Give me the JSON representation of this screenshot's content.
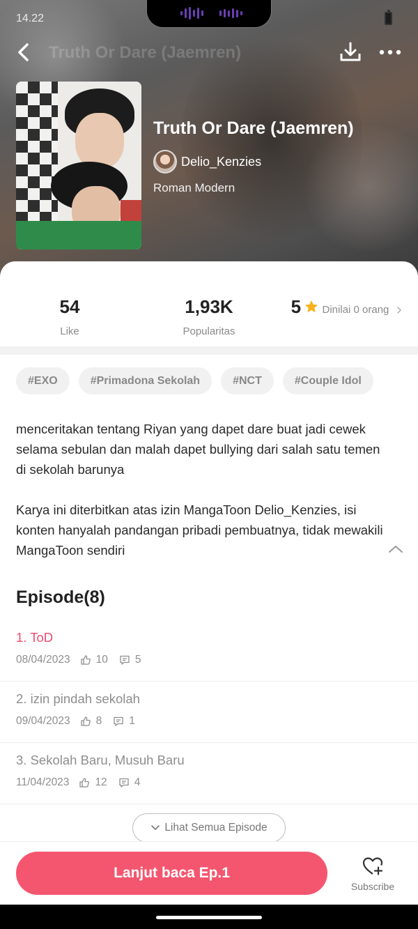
{
  "status_bar": {
    "time": "14.22"
  },
  "header": {
    "title": "Truth Or Dare (Jaemren)"
  },
  "book": {
    "title": "Truth Or Dare (Jaemren)",
    "author": "Delio_Kenzies",
    "genre": "Roman Modern"
  },
  "stats": {
    "likes": {
      "value": "54",
      "label": "Like"
    },
    "popularity": {
      "value": "1,93K",
      "label": "Popularitas"
    },
    "rating": {
      "value": "5",
      "label": "Dinilai 0 orang"
    }
  },
  "tags": [
    "#EXO",
    "#Primadona Sekolah",
    "#NCT",
    "#Couple Idol"
  ],
  "description": {
    "paragraph1": "menceritakan tentang Riyan yang dapet dare buat jadi cewek selama sebulan dan malah dapet bullying dari salah satu temen di sekolah barunya",
    "paragraph2": "Karya ini diterbitkan atas izin MangaToon Delio_Kenzies, isi konten hanyalah pandangan pribadi pembuatnya, tidak mewakili MangaToon sendiri"
  },
  "episodes": {
    "heading": "Episode(8)",
    "items": [
      {
        "title": "1. ToD",
        "date": "08/04/2023",
        "likes": "10",
        "comments": "5"
      },
      {
        "title": "2. izin pindah sekolah",
        "date": "09/04/2023",
        "likes": "8",
        "comments": "1"
      },
      {
        "title": "3. Sekolah Baru, Musuh Baru",
        "date": "11/04/2023",
        "likes": "12",
        "comments": "4"
      }
    ],
    "view_all_label": "Lihat Semua Episode"
  },
  "bottom_bar": {
    "read_label": "Lanjut baca Ep.1",
    "subscribe_label": "Subscribe"
  },
  "colors": {
    "accent": "#f5566f",
    "current_episode": "#ef4b6c",
    "star": "#f6b21b"
  }
}
